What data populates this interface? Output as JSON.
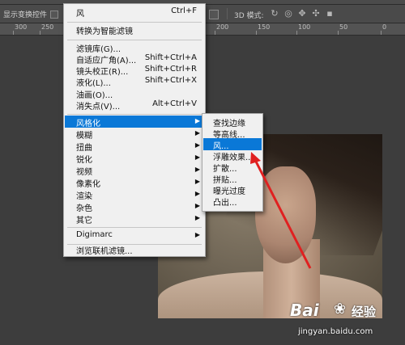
{
  "options_bar": {
    "show_transform_label": "显示变换控件",
    "mode_label": "3D 模式:"
  },
  "ruler": {
    "ticks": [
      "300",
      "250",
      "200",
      "150",
      "100",
      "50",
      "0"
    ]
  },
  "menu": {
    "top": {
      "label": "风",
      "shortcut": "Ctrl+F"
    },
    "convert": {
      "label": "转换为智能滤镜"
    },
    "gallery": {
      "label": "滤镜库(G)..."
    },
    "adaptive_wide": {
      "label": "自适应广角(A)...",
      "shortcut": "Shift+Ctrl+A"
    },
    "lens_correction": {
      "label": "镜头校正(R)...",
      "shortcut": "Shift+Ctrl+R"
    },
    "liquify": {
      "label": "液化(L)...",
      "shortcut": "Shift+Ctrl+X"
    },
    "oil_paint": {
      "label": "油画(O)..."
    },
    "vanishing_point": {
      "label": "消失点(V)...",
      "shortcut": "Alt+Ctrl+V"
    },
    "stylize": {
      "label": "风格化"
    },
    "blur": {
      "label": "模糊"
    },
    "distort": {
      "label": "扭曲"
    },
    "sharpen": {
      "label": "锐化"
    },
    "video": {
      "label": "视频"
    },
    "pixelate": {
      "label": "像素化"
    },
    "render": {
      "label": "渲染"
    },
    "noise": {
      "label": "杂色"
    },
    "other": {
      "label": "其它"
    },
    "digimarc": {
      "label": "Digimarc"
    },
    "browse_online": {
      "label": "浏览联机滤镜..."
    }
  },
  "submenu": {
    "items": [
      "查找边缘",
      "等高线...",
      "风...",
      "浮雕效果...",
      "扩散...",
      "拼贴...",
      "曝光过度",
      "凸出..."
    ]
  },
  "watermark": {
    "logo": "Bai",
    "logo_suffix": "经验",
    "url": "jingyan.baidu.com"
  },
  "colors": {
    "highlight": "#0a78d7",
    "annotation": "#e02020"
  }
}
